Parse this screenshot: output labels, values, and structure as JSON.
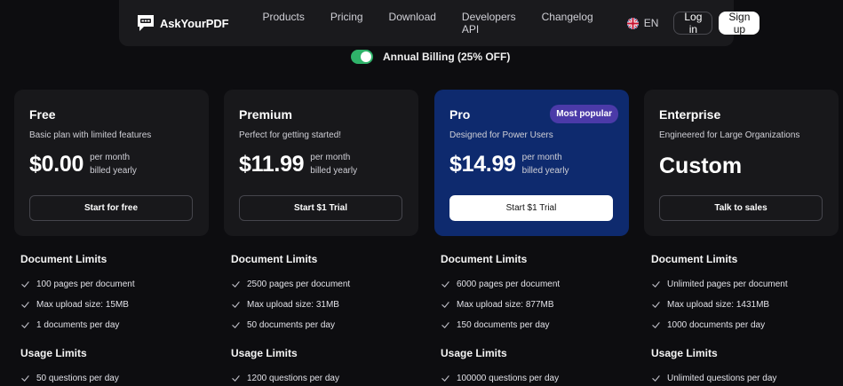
{
  "nav": {
    "brand": "AskYourPDF",
    "links": [
      "Products",
      "Pricing",
      "Download",
      "Developers API",
      "Changelog"
    ],
    "lang": "EN",
    "login": "Log in",
    "signup": "Sign up"
  },
  "billing": {
    "label": "Annual Billing (25% OFF)",
    "enabled": true
  },
  "plans": [
    {
      "title": "Free",
      "subtitle": "Basic plan with limited features",
      "price": "$0.00",
      "per_line1": "per month",
      "per_line2": "billed yearly",
      "cta": "Start for free",
      "doc_title": "Document Limits",
      "doc_features": [
        "100 pages per document",
        "Max upload size: 15MB",
        "1 documents per day"
      ],
      "usage_title": "Usage Limits",
      "usage_features": [
        "50 questions per day"
      ]
    },
    {
      "title": "Premium",
      "subtitle": "Perfect for getting started!",
      "price": "$11.99",
      "per_line1": "per month",
      "per_line2": "billed yearly",
      "cta": "Start $1 Trial",
      "doc_title": "Document Limits",
      "doc_features": [
        "2500 pages per document",
        "Max upload size: 31MB",
        "50 documents per day"
      ],
      "usage_title": "Usage Limits",
      "usage_features": [
        "1200 questions per day"
      ]
    },
    {
      "title": "Pro",
      "subtitle": "Designed for Power Users",
      "badge": "Most popular",
      "price": "$14.99",
      "per_line1": "per month",
      "per_line2": "billed yearly",
      "cta": "Start $1 Trial",
      "doc_title": "Document Limits",
      "doc_features": [
        "6000 pages per document",
        "Max upload size: 877MB",
        "150 documents per day"
      ],
      "usage_title": "Usage Limits",
      "usage_features": [
        "100000 questions per day"
      ]
    },
    {
      "title": "Enterprise",
      "subtitle": "Engineered for Large Organizations",
      "price": "Custom",
      "cta": "Talk to sales",
      "doc_title": "Document Limits",
      "doc_features": [
        "Unlimited pages per document",
        "Max upload size: 1431MB",
        "1000 documents per day"
      ],
      "usage_title": "Usage Limits",
      "usage_features": [
        "Unlimited questions per day"
      ]
    }
  ],
  "colors": {
    "background": "#0d0d10",
    "card": "#18181b",
    "pro_card": "#0e2a6e",
    "badge": "#4b3aa8",
    "toggle_on": "#2fb36a"
  },
  "icons": {
    "brand": "chat-pdf-logo-icon",
    "lang": "uk-flag-icon",
    "feature": "check-icon"
  }
}
